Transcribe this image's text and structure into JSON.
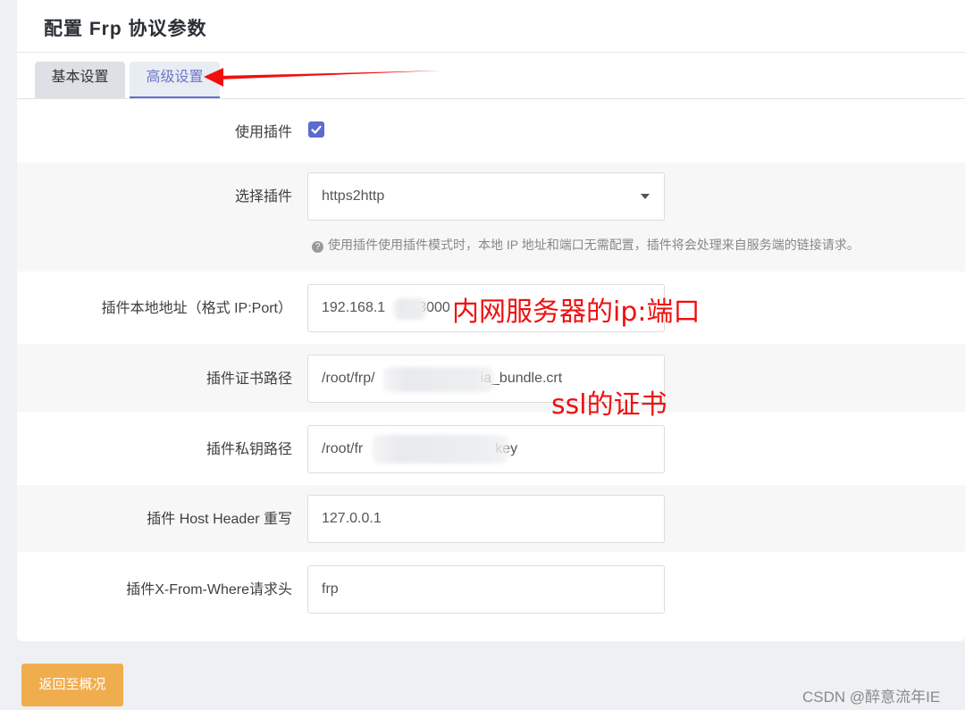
{
  "card": {
    "title": "配置 Frp 协议参数"
  },
  "tabs": [
    {
      "label": "基本设置",
      "active": false
    },
    {
      "label": "高级设置",
      "active": true
    }
  ],
  "form": {
    "use_plugin": {
      "label": "使用插件",
      "checked": true
    },
    "select_plugin": {
      "label": "选择插件",
      "value": "https2http",
      "hint": "使用插件使用插件模式时，本地 IP 地址和端口无需配置，插件将会处理来自服务端的链接请求。"
    },
    "plugin_local_addr": {
      "label": "插件本地地址（格式 IP:Port）",
      "value_start": "192.168.1",
      "value_end": "3000"
    },
    "plugin_crt_path": {
      "label": "插件证书路径",
      "value_start": "/root/frp/",
      "value_end": "ia_bundle.crt"
    },
    "plugin_key_path": {
      "label": "插件私钥路径",
      "value_start": "/root/fr",
      "value_end": "key"
    },
    "plugin_host_header": {
      "label": "插件 Host Header 重写",
      "value": "127.0.0.1"
    },
    "plugin_x_from_where": {
      "label": "插件X-From-Where请求头",
      "value": "frp"
    }
  },
  "annotations": {
    "ip_port": "内网服务器的ip:端口",
    "ssl_cert": "ssl的证书",
    "color": "#f00f0f"
  },
  "footer": {
    "back_button": "返回至概况"
  },
  "watermark": "CSDN @醉意流年IE",
  "colors": {
    "accent": "#5b6bd0",
    "button": "#f0ad4e"
  }
}
